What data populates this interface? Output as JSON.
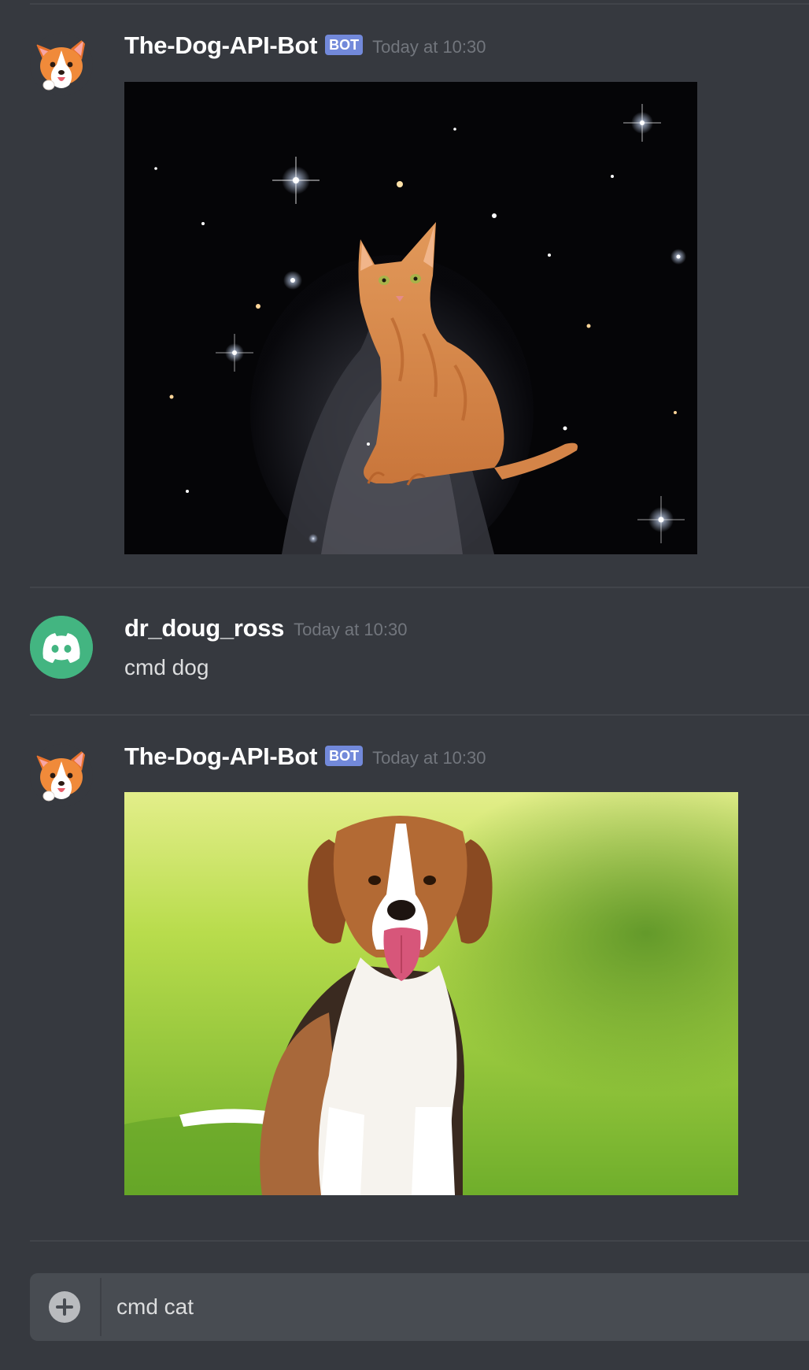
{
  "messages": [
    {
      "username": "The-Dog-API-Bot",
      "bot_tag": "BOT",
      "timestamp": "Today at 10:30",
      "avatar": "corgi-avatar",
      "attachment": "cat-in-space-image"
    },
    {
      "username": "dr_doug_ross",
      "timestamp": "Today at 10:30",
      "avatar": "discord-default-avatar",
      "text": "cmd dog"
    },
    {
      "username": "The-Dog-API-Bot",
      "bot_tag": "BOT",
      "timestamp": "Today at 10:30",
      "avatar": "corgi-avatar",
      "attachment": "beagle-on-grass-image"
    }
  ],
  "composer": {
    "value": "cmd cat",
    "add_icon": "plus-circle-icon"
  },
  "colors": {
    "background": "#36393f",
    "composer_bg": "#484c52",
    "bot_tag": "#7289da",
    "username": "#ffffff",
    "timestamp": "#72767d",
    "message_text": "#dcddde",
    "discord_green": "#43b581"
  }
}
